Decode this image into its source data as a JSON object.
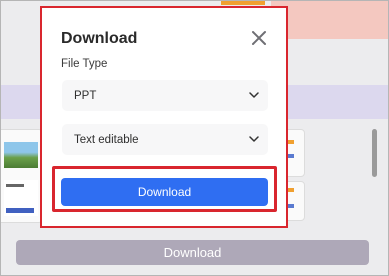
{
  "dialog": {
    "title": "Download",
    "file_type_label": "File Type",
    "file_type_selected": "PPT",
    "edit_mode_selected": "Text editable",
    "primary_button_label": "Download"
  },
  "background": {
    "download_button_label": "Download"
  },
  "icons": {
    "close": "close-icon",
    "chevron": "chevron-down-icon"
  },
  "colors": {
    "primary": "#2f6ef2",
    "highlight": "#d9262e",
    "disabled_button": "#aea8b8"
  }
}
